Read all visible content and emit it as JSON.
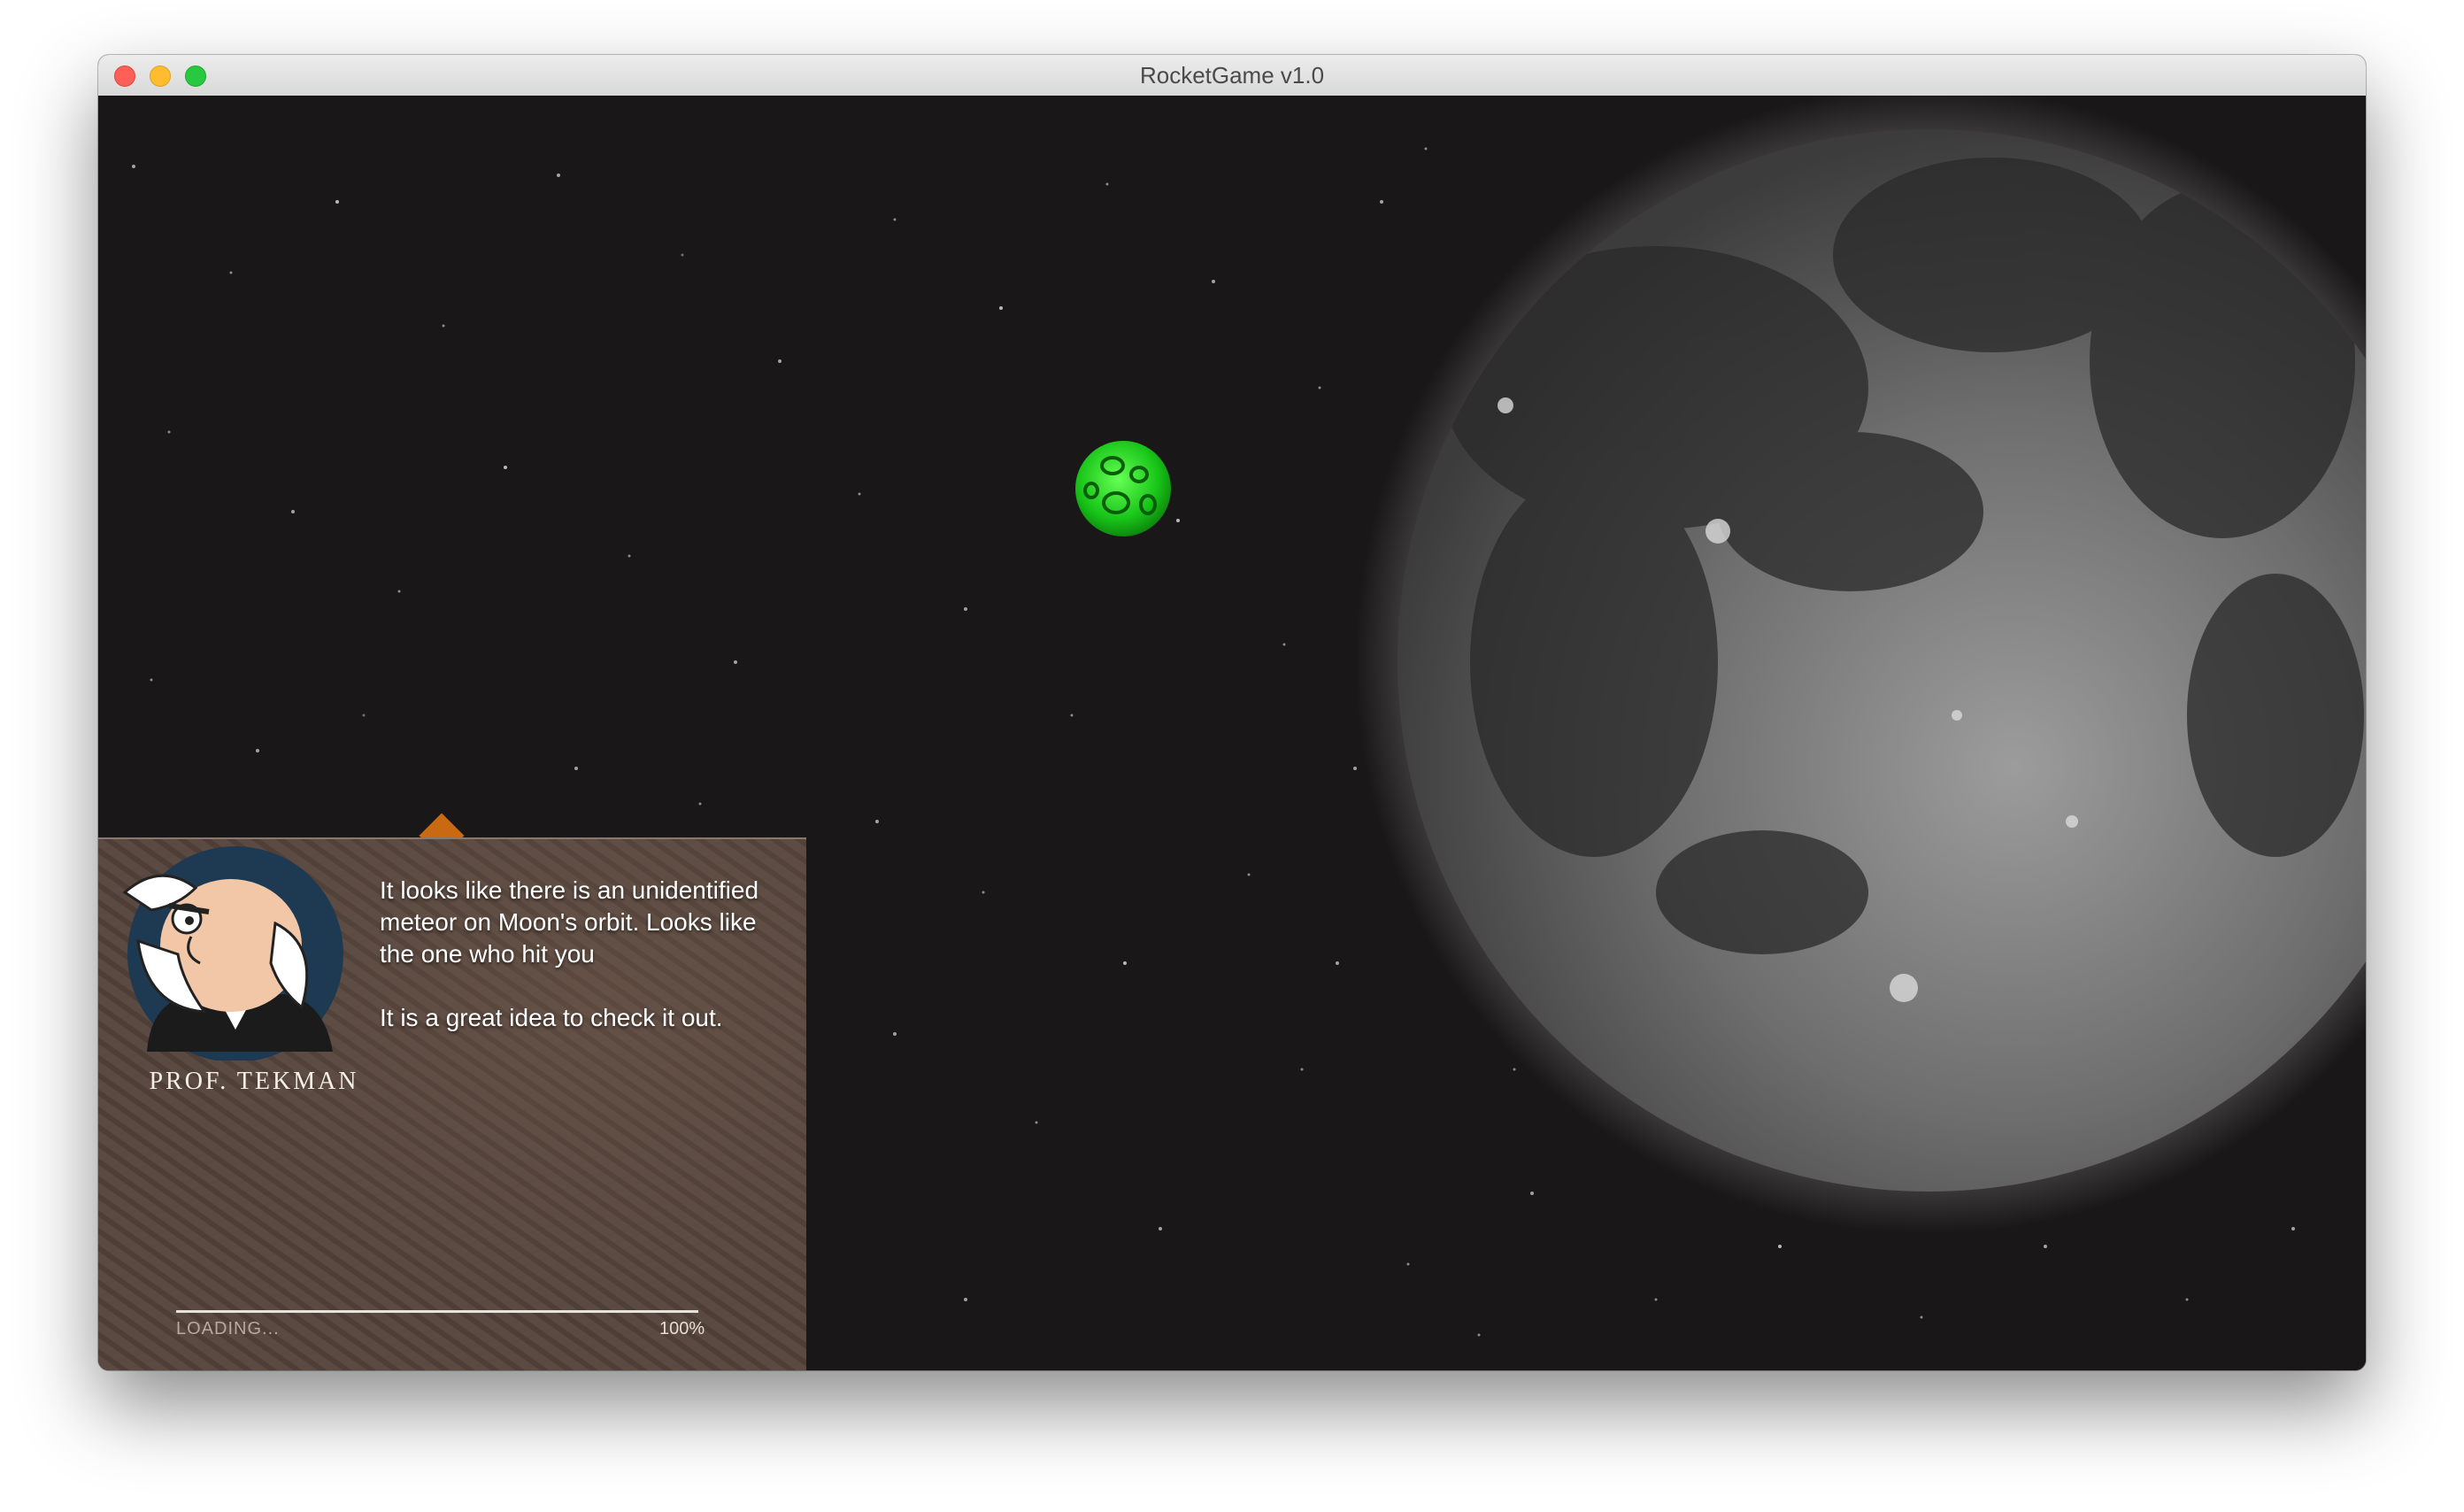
{
  "window": {
    "title": "RocketGame v1.0"
  },
  "scene": {
    "objects": [
      {
        "name": "moon",
        "color": "#8a8a8a"
      },
      {
        "name": "green-meteor",
        "color": "#1ed11e"
      }
    ]
  },
  "dialog": {
    "speaker": "PROF. TEKMAN",
    "lines": [
      "It looks like there is an unidentified meteor on Moon's orbit. Looks like the one who hit you",
      "It is a great idea to check it out."
    ],
    "loading": {
      "label": "LOADING...",
      "percent": "100%",
      "progress": 1.0
    }
  },
  "colors": {
    "space": "#1a1719",
    "dialog_bg": "#5a4a42",
    "marker": "#c96a12"
  }
}
